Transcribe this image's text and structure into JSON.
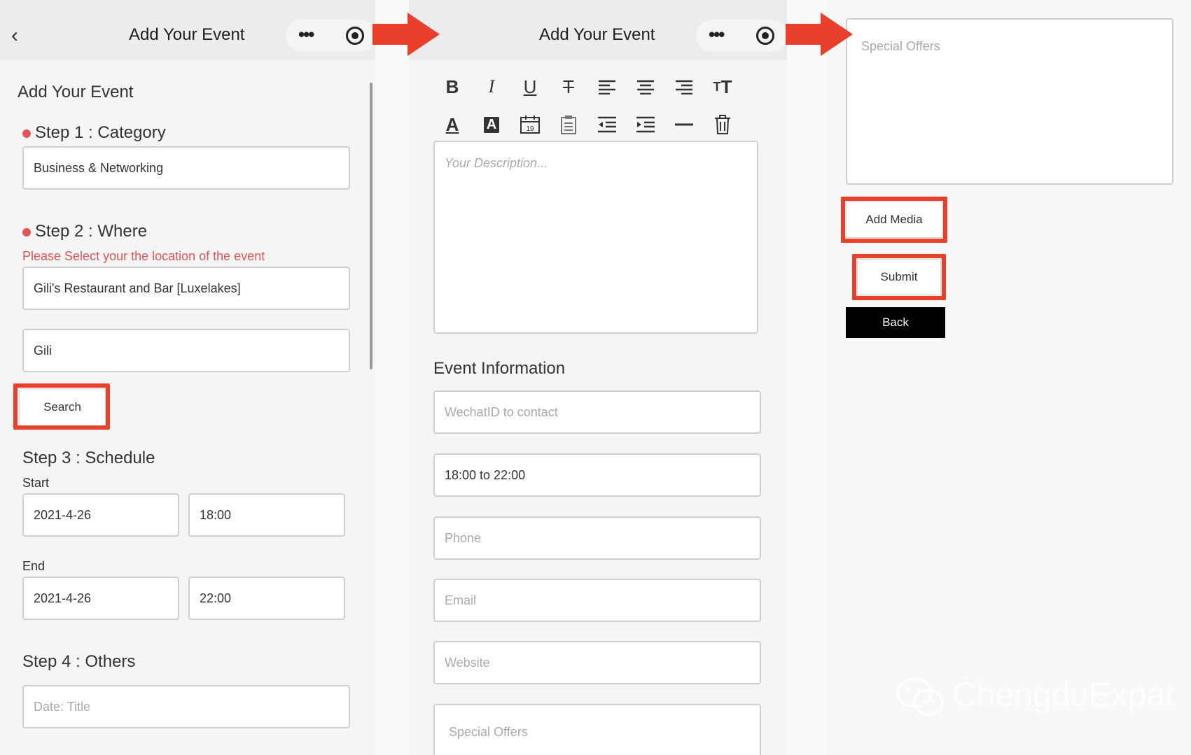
{
  "panel1": {
    "nav_title": "Add Your Event",
    "page_heading": "Add Your Event",
    "step1_label": "Step 1 : Category",
    "category_value": "Business & Networking",
    "step2_label": "Step 2 : Where",
    "location_hint": "Please Select your the location of the event",
    "location_value": "Gili's Restaurant and Bar [Luxelakes]",
    "search_query": "Gili",
    "search_button": "Search",
    "step3_label": "Step 3 : Schedule",
    "start_label": "Start",
    "start_date": "2021-4-26",
    "start_time": "18:00",
    "end_label": "End",
    "end_date": "2021-4-26",
    "end_time": "22:00",
    "step4_label": "Step 4 : Others",
    "title_placeholder": "Date: Title"
  },
  "panel2": {
    "nav_title": "Add Your Event",
    "description_placeholder": "Your Description...",
    "event_info_heading": "Event Information",
    "wechat_placeholder": "WechatID to contact",
    "time_value": "18:00 to 22:00",
    "phone_placeholder": "Phone",
    "email_placeholder": "Email",
    "website_placeholder": "Website",
    "special_offers_placeholder": "Special Offers"
  },
  "panel3": {
    "special_offers_placeholder": "Special Offers",
    "add_media_button": "Add Media",
    "submit_button": "Submit",
    "back_button": "Back"
  },
  "watermark": "ChengduExpat",
  "colors": {
    "highlight": "#e8402a",
    "hint_red": "#e05555",
    "back_button_bg": "#000000"
  }
}
